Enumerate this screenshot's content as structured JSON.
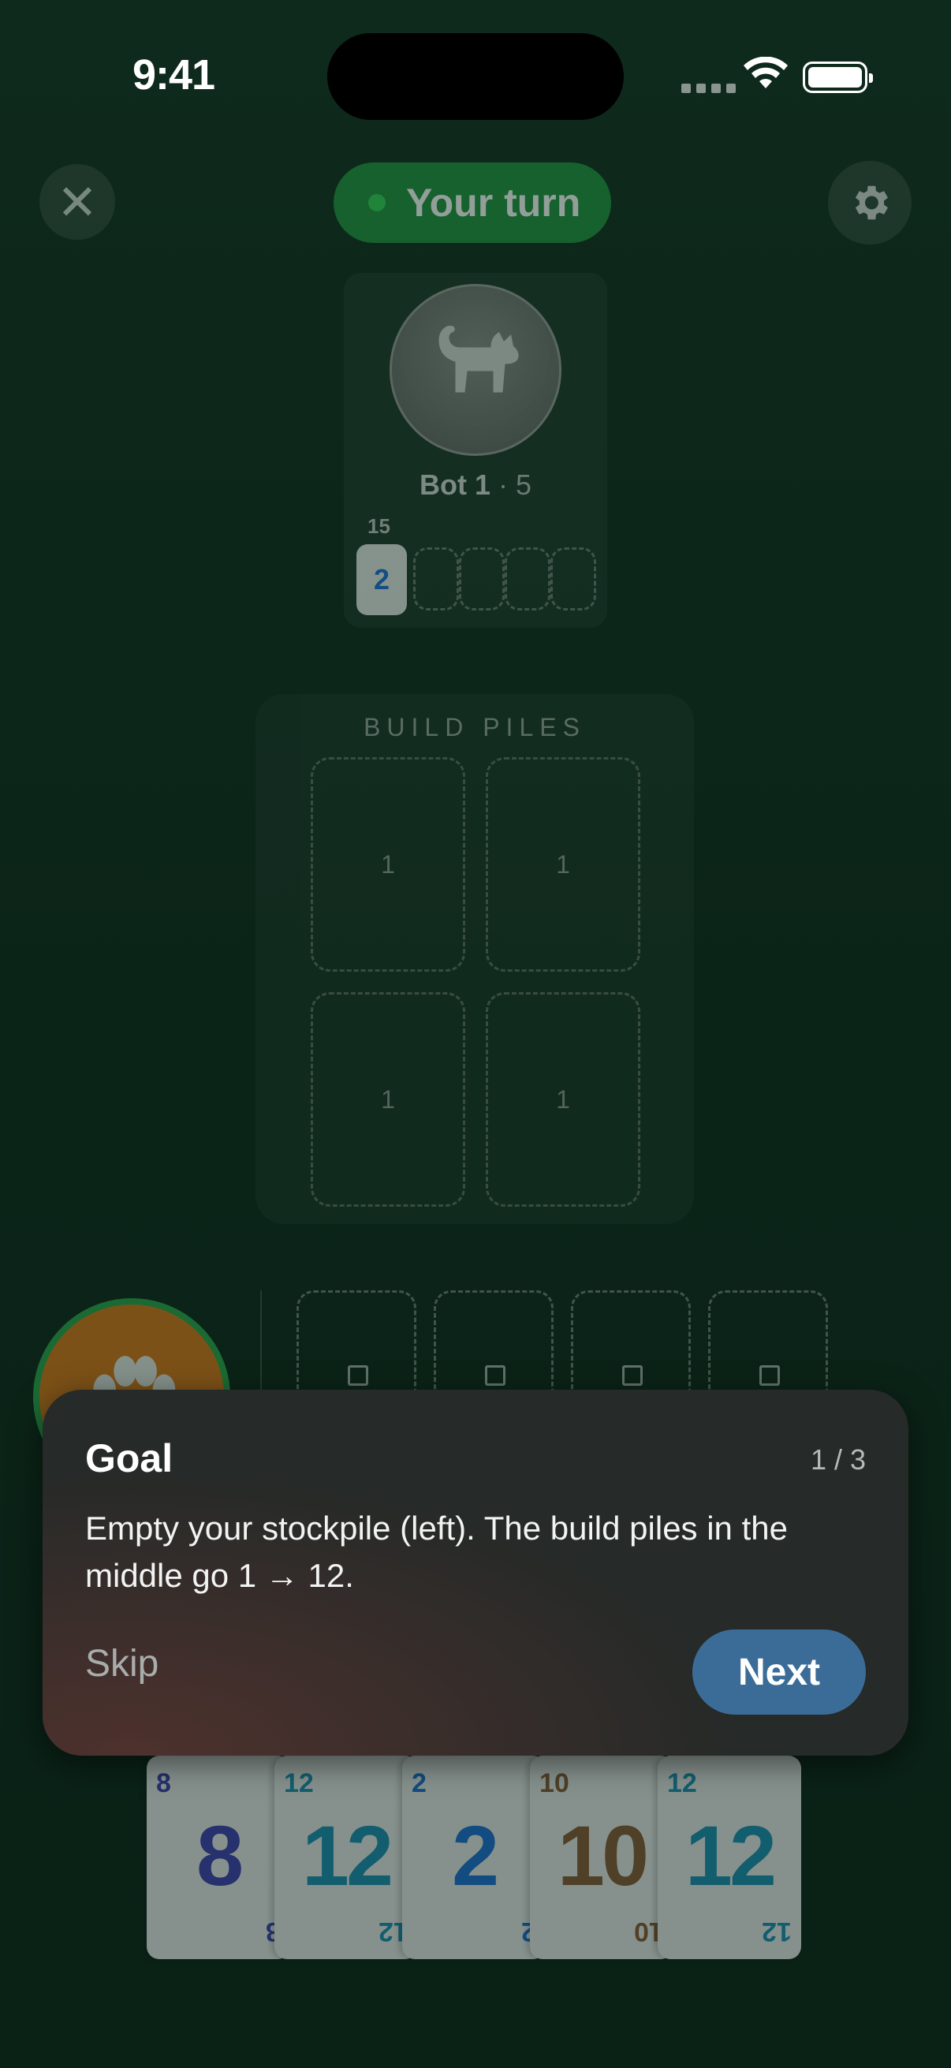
{
  "status": {
    "time": "9:41"
  },
  "header": {
    "turn_label": "Your turn",
    "close_icon": "close-icon",
    "settings_icon": "gear-icon"
  },
  "bot": {
    "name": "Bot 1",
    "score_text": "· 5",
    "stock_count": "15",
    "stock_top": "2",
    "avatar_icon": "cat-icon"
  },
  "build": {
    "title": "BUILD PILES",
    "piles": [
      "1",
      "1",
      "1",
      "1"
    ]
  },
  "player": {
    "avatar_icon": "paw-icon"
  },
  "hand": [
    {
      "value": "8",
      "color": "#3d3fb5"
    },
    {
      "value": "12",
      "color": "#1b8fb7"
    },
    {
      "value": "2",
      "color": "#1b6fd8"
    },
    {
      "value": "10",
      "color": "#8a5a35"
    },
    {
      "value": "12",
      "color": "#1b8fb7"
    }
  ],
  "tutorial": {
    "title": "Goal",
    "step": "1 / 3",
    "body": "Empty your stockpile (left). The build piles in the middle go 1 → 12.",
    "skip_label": "Skip",
    "next_label": "Next"
  }
}
